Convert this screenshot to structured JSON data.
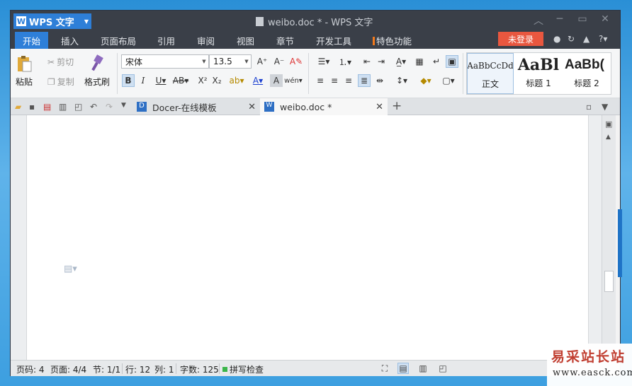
{
  "app": {
    "name": "WPS 文字",
    "logo_letter": "W"
  },
  "window": {
    "title": "weibo.doc * - WPS 文字"
  },
  "menu": {
    "items": [
      "开始",
      "插入",
      "页面布局",
      "引用",
      "审阅",
      "视图",
      "章节",
      "开发工具",
      "特色功能"
    ],
    "login": "未登录"
  },
  "ribbon": {
    "paste": "粘贴",
    "cut": "剪切",
    "copy": "复制",
    "format_painter": "格式刷",
    "font_name": "宋体",
    "font_size": "13.5",
    "styles": [
      {
        "preview": "AaBbCcDd",
        "name": "正文"
      },
      {
        "preview": "AaBl",
        "name": "标题 1"
      },
      {
        "preview": "AaBb(",
        "name": "标题 2"
      }
    ]
  },
  "tabs": [
    {
      "label": "Docer-在线模板",
      "active": false
    },
    {
      "label": "weibo.doc *",
      "active": true
    }
  ],
  "status": {
    "page_num": "页码: 4",
    "pages": "页面: 4/4",
    "section": "节: 1/1",
    "row": "行: 12",
    "col": "列: 1",
    "words": "字数: 125",
    "spell": "拼写检查"
  },
  "watermark": {
    "text": "易采站长站",
    "url": "www.easck.com"
  },
  "colors": {
    "titlebar": "#3a3f48",
    "accent": "#2e7fd8",
    "login": "#e9573f",
    "feature_bar": "#f27a1c"
  }
}
